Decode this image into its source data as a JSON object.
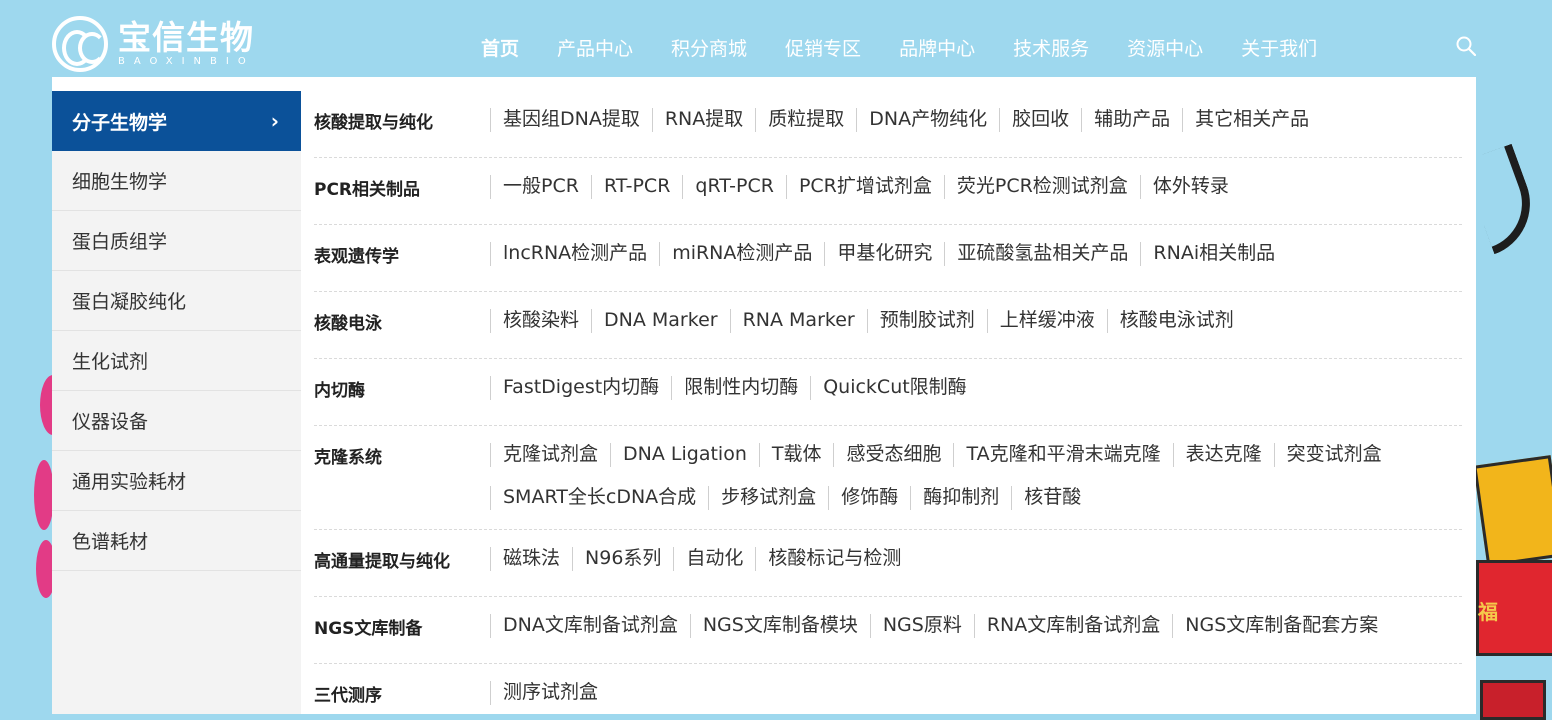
{
  "brand": {
    "name_cn": "宝信生物",
    "name_en": "BAOXINBIO"
  },
  "nav": [
    {
      "label": "首页",
      "active": true
    },
    {
      "label": "产品中心"
    },
    {
      "label": "积分商城"
    },
    {
      "label": "促销专区"
    },
    {
      "label": "品牌中心"
    },
    {
      "label": "技术服务"
    },
    {
      "label": "资源中心"
    },
    {
      "label": "关于我们"
    }
  ],
  "sidebar": [
    {
      "label": "分子生物学",
      "active": true
    },
    {
      "label": "细胞生物学"
    },
    {
      "label": "蛋白质组学"
    },
    {
      "label": "蛋白凝胶纯化"
    },
    {
      "label": "生化试剂"
    },
    {
      "label": "仪器设备"
    },
    {
      "label": "通用实验耗材"
    },
    {
      "label": "色谱耗材"
    }
  ],
  "categories": [
    {
      "title": "核酸提取与纯化",
      "links": [
        "基因组DNA提取",
        "RNA提取",
        "质粒提取",
        "DNA产物纯化",
        "胶回收",
        "辅助产品",
        "其它相关产品"
      ]
    },
    {
      "title": "PCR相关制品",
      "links": [
        "一般PCR",
        "RT-PCR",
        "qRT-PCR",
        "PCR扩增试剂盒",
        "荧光PCR检测试剂盒",
        "体外转录"
      ]
    },
    {
      "title": "表观遗传学",
      "links": [
        "lncRNA检测产品",
        "miRNA检测产品",
        "甲基化研究",
        "亚硫酸氢盐相关产品",
        "RNAi相关制品"
      ]
    },
    {
      "title": "核酸电泳",
      "links": [
        "核酸染料",
        "DNA Marker",
        "RNA Marker",
        "预制胶试剂",
        "上样缓冲液",
        "核酸电泳试剂"
      ]
    },
    {
      "title": "内切酶",
      "links": [
        "FastDigest内切酶",
        "限制性内切酶",
        "QuickCut限制酶"
      ]
    },
    {
      "title": "克隆系统",
      "links": [
        "克隆试剂盒",
        "DNA Ligation",
        "T载体",
        "感受态细胞",
        "TA克隆和平滑末端克隆",
        "表达克隆",
        "突变试剂盒",
        "SMART全长cDNA合成",
        "步移试剂盒",
        "修饰酶",
        "酶抑制剂",
        "核苷酸"
      ]
    },
    {
      "title": "高通量提取与纯化",
      "links": [
        "磁珠法",
        "N96系列",
        "自动化",
        "核酸标记与检测"
      ]
    },
    {
      "title": "NGS文库制备",
      "links": [
        "DNA文库制备试剂盒",
        "NGS文库制备模块",
        "NGS原料",
        "RNA文库制备试剂盒",
        "NGS文库制备配套方案"
      ]
    },
    {
      "title": "三代测序",
      "links": [
        "测序试剂盒"
      ]
    }
  ],
  "decor": {
    "fu_char": "福"
  },
  "colors": {
    "background": "#9ed8ee",
    "active_sidebar": "#0b5199",
    "panel": "#ffffff",
    "sidebar": "#f3f3f3"
  },
  "icons": {
    "search": "search-icon",
    "chevron": "chevron-right-icon"
  }
}
